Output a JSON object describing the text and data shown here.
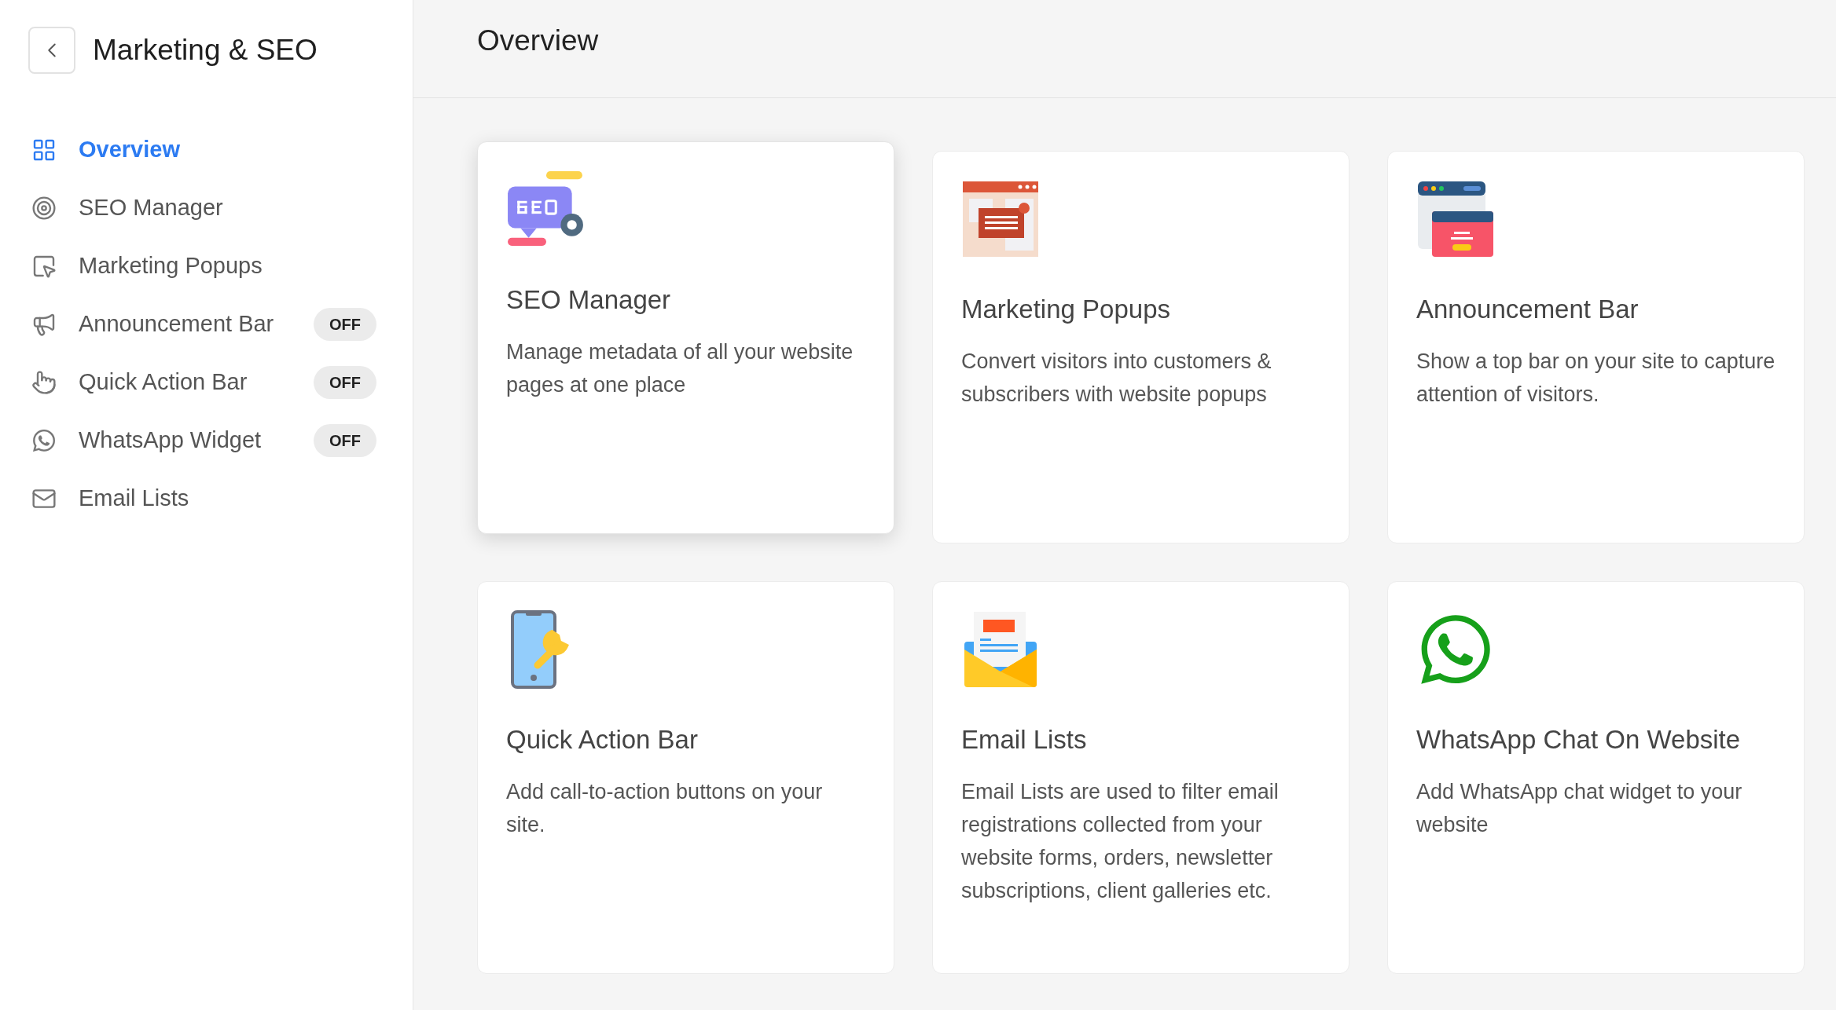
{
  "sidebar": {
    "title": "Marketing & SEO",
    "items": [
      {
        "label": "Overview",
        "selected": true
      },
      {
        "label": "SEO Manager",
        "selected": false
      },
      {
        "label": "Marketing Popups",
        "selected": false
      },
      {
        "label": "Announcement Bar",
        "selected": false,
        "badge": "OFF"
      },
      {
        "label": "Quick Action Bar",
        "selected": false,
        "badge": "OFF"
      },
      {
        "label": "WhatsApp Widget",
        "selected": false,
        "badge": "OFF"
      },
      {
        "label": "Email Lists",
        "selected": false
      }
    ]
  },
  "header": {
    "title": "Overview"
  },
  "cards": [
    {
      "title": "SEO Manager",
      "description": "Manage metadata of all your website pages at one place",
      "highlighted": true
    },
    {
      "title": "Marketing Popups",
      "description": "Convert visitors into customers & subscribers with website popups",
      "highlighted": false
    },
    {
      "title": "Announcement Bar",
      "description": "Show a top bar on your site to capture attention of visitors.",
      "highlighted": false
    },
    {
      "title": "Quick Action Bar",
      "description": "Add call-to-action buttons on your site.",
      "highlighted": false
    },
    {
      "title": "Email Lists",
      "description": "Email Lists are used to filter email registrations collected from your website forms, orders, newsletter subscriptions, client galleries etc.",
      "highlighted": false
    },
    {
      "title": "WhatsApp Chat On Website",
      "description": "Add WhatsApp chat widget to your website",
      "highlighted": false
    }
  ]
}
